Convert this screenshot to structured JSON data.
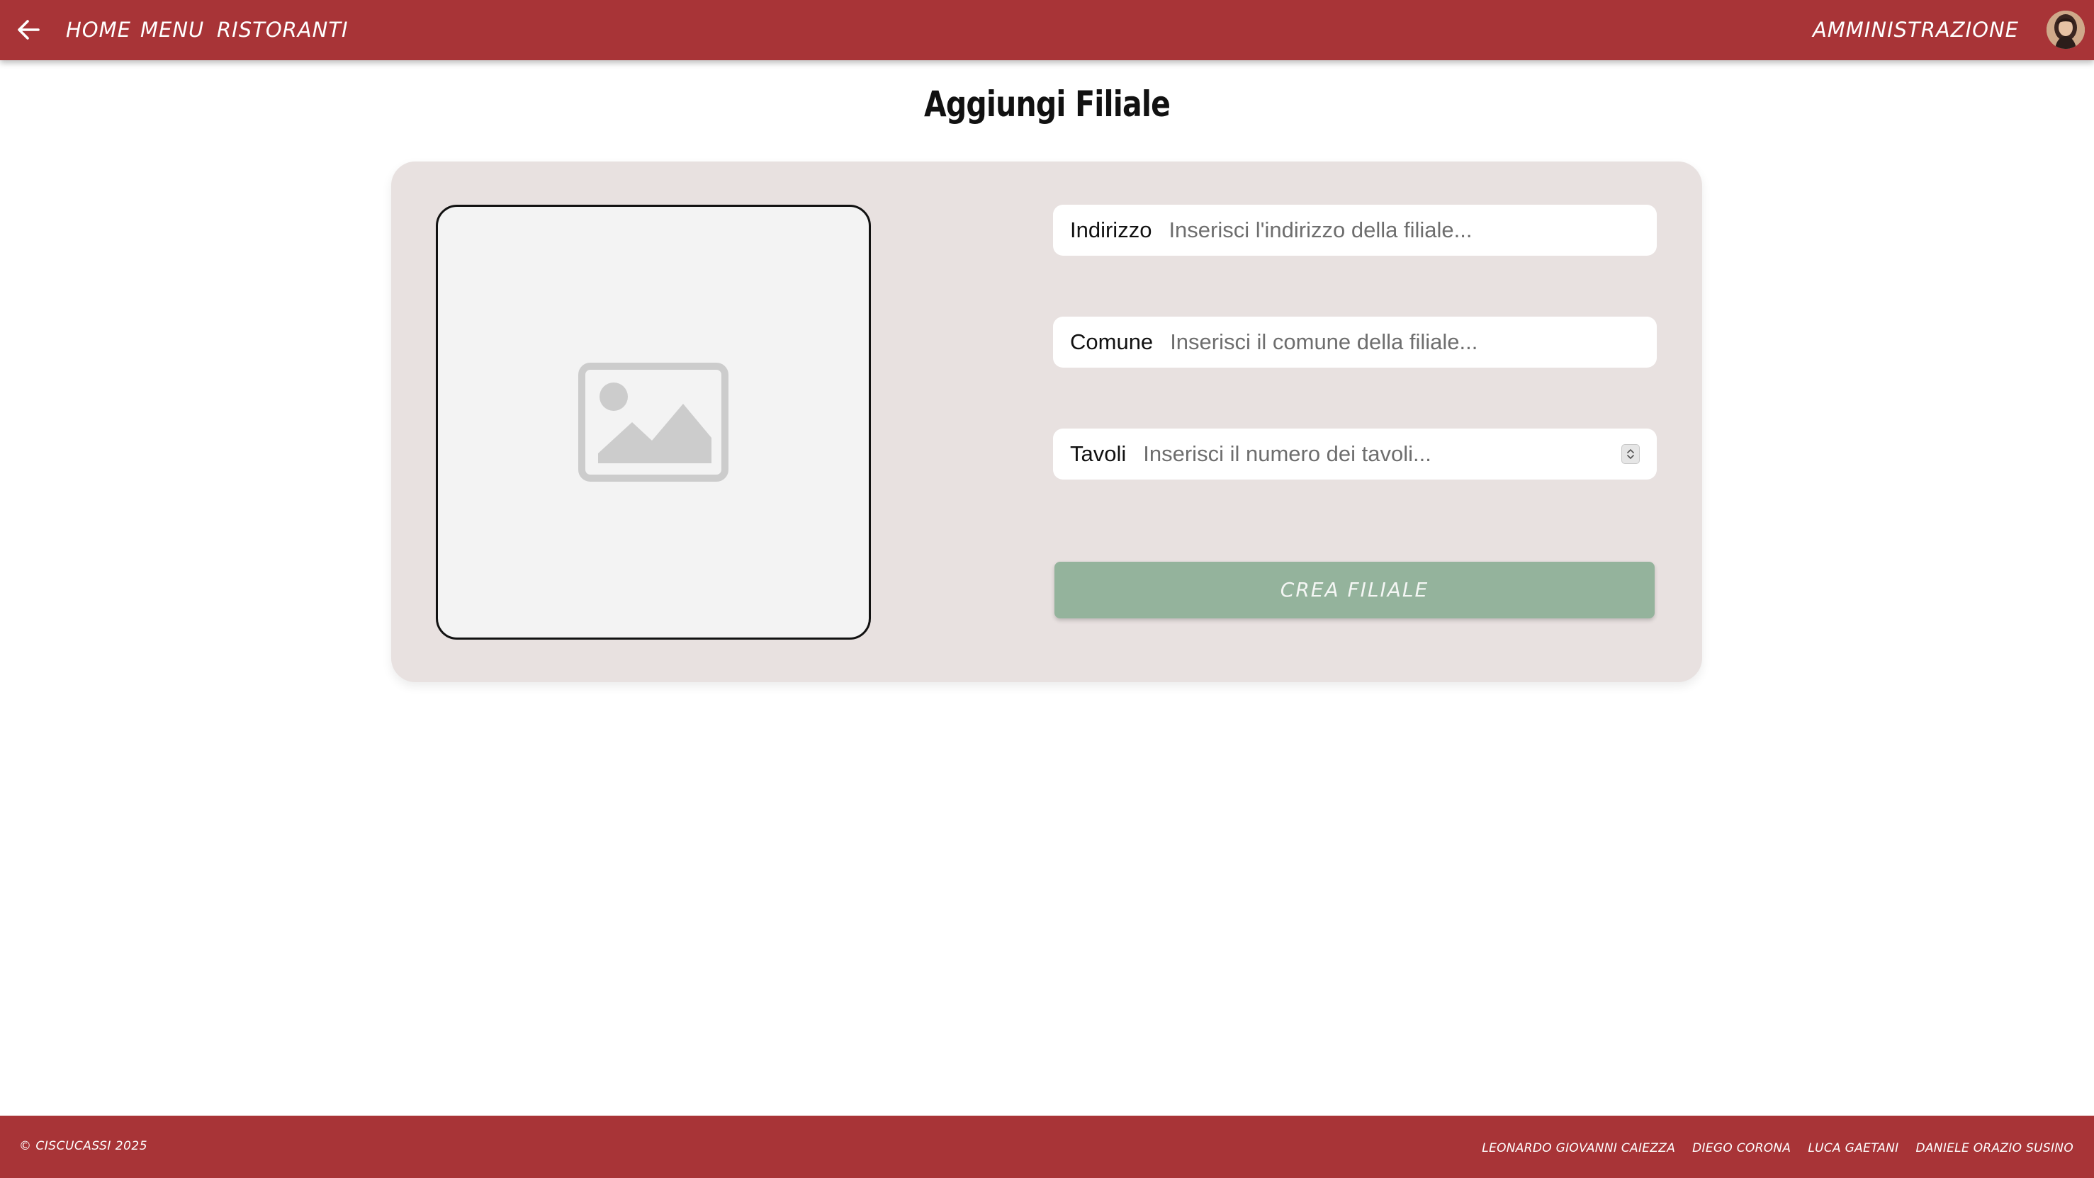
{
  "header": {
    "back_icon": "arrow-left-icon",
    "nav": [
      {
        "label": "HOME"
      },
      {
        "label": "MENU"
      },
      {
        "label": "RISTORANTI"
      }
    ],
    "admin_label": "AMMINISTRAZIONE",
    "avatar_icon": "user-avatar"
  },
  "main": {
    "title": "Aggiungi Filiale",
    "image_placeholder_icon": "image-placeholder-icon",
    "fields": {
      "indirizzo": {
        "label": "Indirizzo",
        "value": "",
        "placeholder": "Inserisci l'indirizzo della filiale..."
      },
      "comune": {
        "label": "Comune",
        "value": "",
        "placeholder": "Inserisci il comune della filiale..."
      },
      "tavoli": {
        "label": "Tavoli",
        "value": "",
        "placeholder": "Inserisci il numero dei tavoli..."
      }
    },
    "submit_label": "CREA FILIALE"
  },
  "footer": {
    "copyright": "© CISCUCASSI 2025",
    "authors": [
      "LEONARDO GIOVANNI CAIEZZA",
      "DIEGO CORONA",
      "LUCA GAETANI",
      "DANIELE ORAZIO SUSINO"
    ]
  },
  "colors": {
    "brand": "#a83437",
    "card_background": "#e8e1e0",
    "submit_button": "#94b39c"
  }
}
